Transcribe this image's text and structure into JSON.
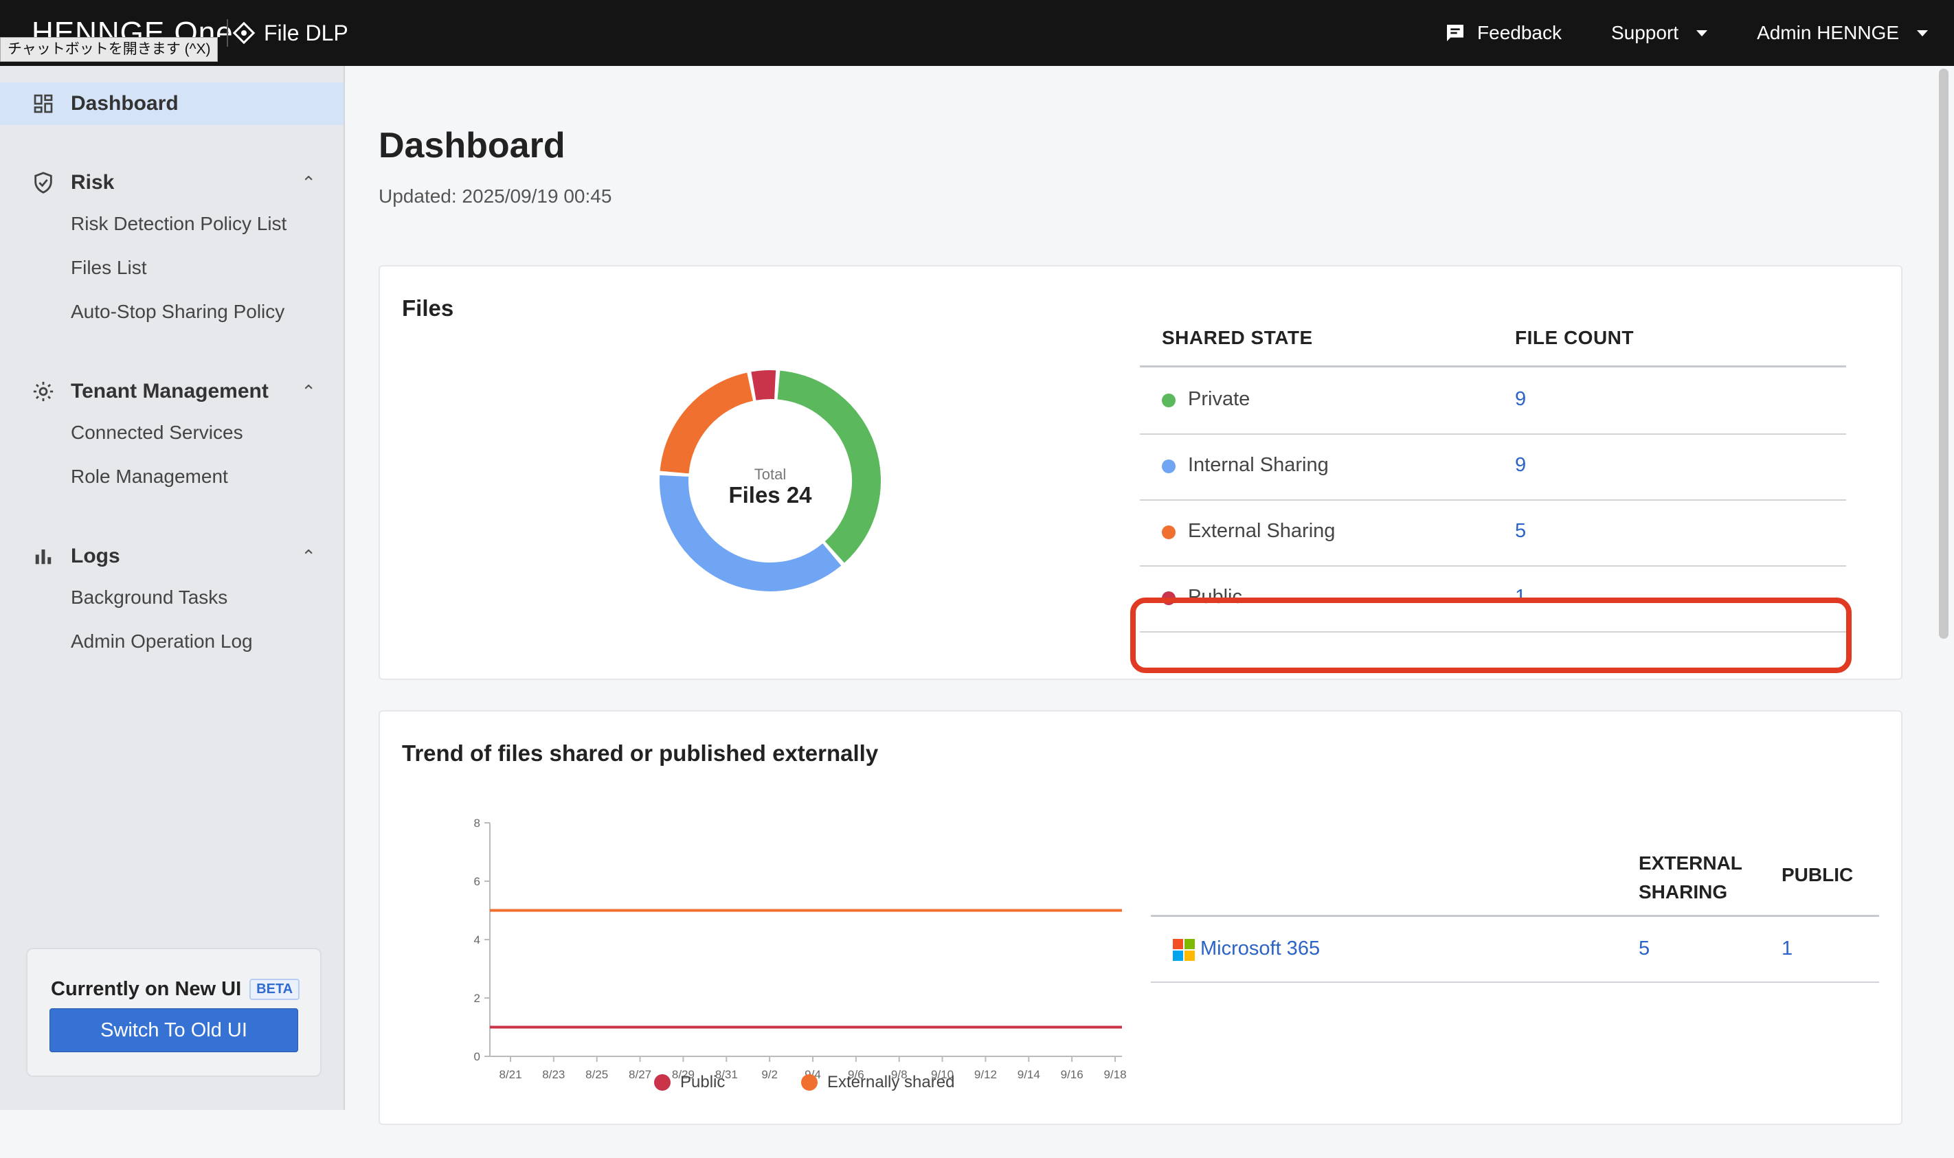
{
  "header": {
    "logo": "HENNGE One",
    "product": "File DLP",
    "tooltip": "チャットボットを開きます (^X)",
    "feedback": "Feedback",
    "support": "Support",
    "admin": "Admin HENNGE"
  },
  "sidebar": {
    "dashboard": "Dashboard",
    "risk": {
      "label": "Risk",
      "items": [
        "Risk Detection Policy List",
        "Files List",
        "Auto-Stop Sharing Policy"
      ]
    },
    "tenant": {
      "label": "Tenant Management",
      "items": [
        "Connected Services",
        "Role Management"
      ]
    },
    "logs": {
      "label": "Logs",
      "items": [
        "Background Tasks",
        "Admin Operation Log"
      ]
    },
    "beta_card": {
      "title": "Currently on New UI",
      "badge": "BETA",
      "button": "Switch To Old UI"
    }
  },
  "main": {
    "title": "Dashboard",
    "updated": "Updated: 2025/09/19 00:45",
    "files_card": {
      "title": "Files",
      "donut_caption": "Total",
      "donut_total": "Files 24",
      "col_state": "SHARED STATE",
      "col_count": "FILE COUNT",
      "rows": [
        {
          "label": "Private",
          "count": "9",
          "color": "#5cb85c"
        },
        {
          "label": "Internal Sharing",
          "count": "9",
          "color": "#6fa5f3"
        },
        {
          "label": "External Sharing",
          "count": "5",
          "color": "#f07030"
        },
        {
          "label": "Public",
          "count": "1",
          "color": "#c9344a"
        }
      ]
    },
    "trend_card": {
      "title": "Trend of files shared or published externally",
      "col_external_1": "EXTERNAL",
      "col_external_2": "SHARING",
      "col_public": "PUBLIC",
      "service": {
        "name": "Microsoft 365",
        "external": "5",
        "public": "1"
      }
    }
  },
  "chart_data": {
    "type": "line",
    "x": [
      "8/21",
      "8/23",
      "8/25",
      "8/27",
      "8/29",
      "8/31",
      "9/2",
      "9/4",
      "9/6",
      "9/8",
      "9/10",
      "9/12",
      "9/14",
      "9/16",
      "9/18"
    ],
    "ylim": [
      0,
      8
    ],
    "yticks": [
      0,
      2,
      4,
      6,
      8
    ],
    "series": [
      {
        "name": "Public",
        "color": "#c9344a",
        "values": [
          1,
          1,
          1,
          1,
          1,
          1,
          1,
          1,
          1,
          1,
          1,
          1,
          1,
          1,
          1
        ]
      },
      {
        "name": "Externally shared",
        "color": "#f07030",
        "values": [
          5,
          5,
          5,
          5,
          5,
          5,
          5,
          5,
          5,
          5,
          5,
          5,
          5,
          5,
          5
        ]
      }
    ],
    "legend": "bottom"
  }
}
